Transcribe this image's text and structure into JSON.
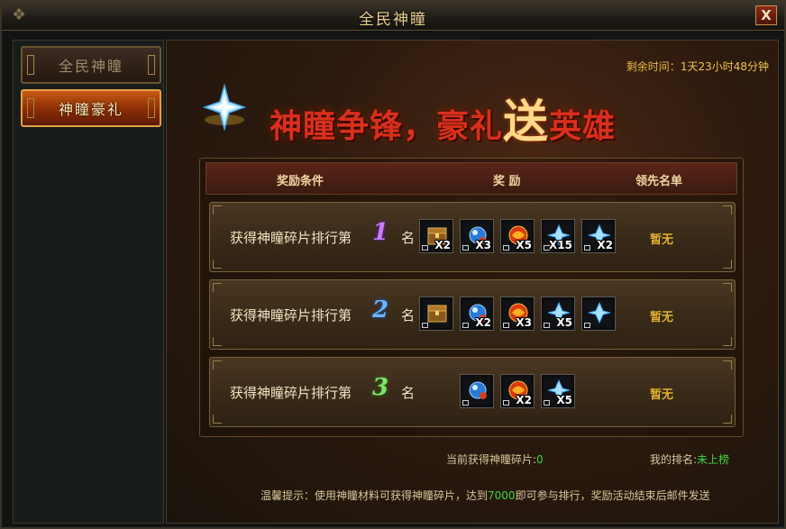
{
  "window": {
    "title": "全民神瞳",
    "close_label": "X"
  },
  "sidebar": {
    "tabs": [
      {
        "label": "全民神瞳",
        "active": false
      },
      {
        "label": "神瞳豪礼",
        "active": true
      }
    ]
  },
  "main": {
    "remaining_label": "剩余时间：",
    "remaining_value": "1天23小时48分钟",
    "banner": {
      "part1": "神瞳争锋，豪礼",
      "big": "送",
      "part2": "英雄"
    },
    "table": {
      "headers": {
        "condition": "奖励条件",
        "reward": "奖 励",
        "leaders": "领先名单"
      },
      "rows": [
        {
          "condition": "获得神瞳碎片排行第",
          "rank": "1",
          "suffix": "名",
          "leader": "暂无",
          "items": [
            {
              "icon": "treasure-chest-icon",
              "qty": "X2"
            },
            {
              "icon": "blue-orb-icon",
              "qty": "X3"
            },
            {
              "icon": "red-dragon-gem-icon",
              "qty": "X5"
            },
            {
              "icon": "crystal-shard-icon",
              "qty": "X15"
            },
            {
              "icon": "crystal-shard-icon",
              "qty": "X2"
            }
          ]
        },
        {
          "condition": "获得神瞳碎片排行第",
          "rank": "2",
          "suffix": "名",
          "leader": "暂无",
          "items": [
            {
              "icon": "treasure-chest-icon",
              "qty": ""
            },
            {
              "icon": "blue-orb-icon",
              "qty": "X2"
            },
            {
              "icon": "red-dragon-gem-icon",
              "qty": "X3"
            },
            {
              "icon": "crystal-shard-icon",
              "qty": "X5"
            },
            {
              "icon": "crystal-shard-icon",
              "qty": ""
            }
          ]
        },
        {
          "condition": "获得神瞳碎片排行第",
          "rank": "3",
          "suffix": "名",
          "leader": "暂无",
          "items": [
            {
              "icon": "blue-orb-icon",
              "qty": ""
            },
            {
              "icon": "red-dragon-gem-icon",
              "qty": "X2"
            },
            {
              "icon": "crystal-shard-icon",
              "qty": "X5"
            }
          ]
        }
      ]
    },
    "current_label": "当前获得神瞳碎片:",
    "current_value": "0",
    "my_rank_label": "我的排名:",
    "my_rank_value": "未上榜",
    "tip_prefix": "温馨提示：使用神瞳材料可获得神瞳碎片，达到",
    "tip_number": "7000",
    "tip_suffix": "即可参与排行，奖励活动结束后邮件发送"
  },
  "colors": {
    "accent_gold": "#e8cf8e",
    "active_tab": "#c85a14",
    "highlight_green": "#3fd33f",
    "leader_gold": "#e0b030"
  }
}
